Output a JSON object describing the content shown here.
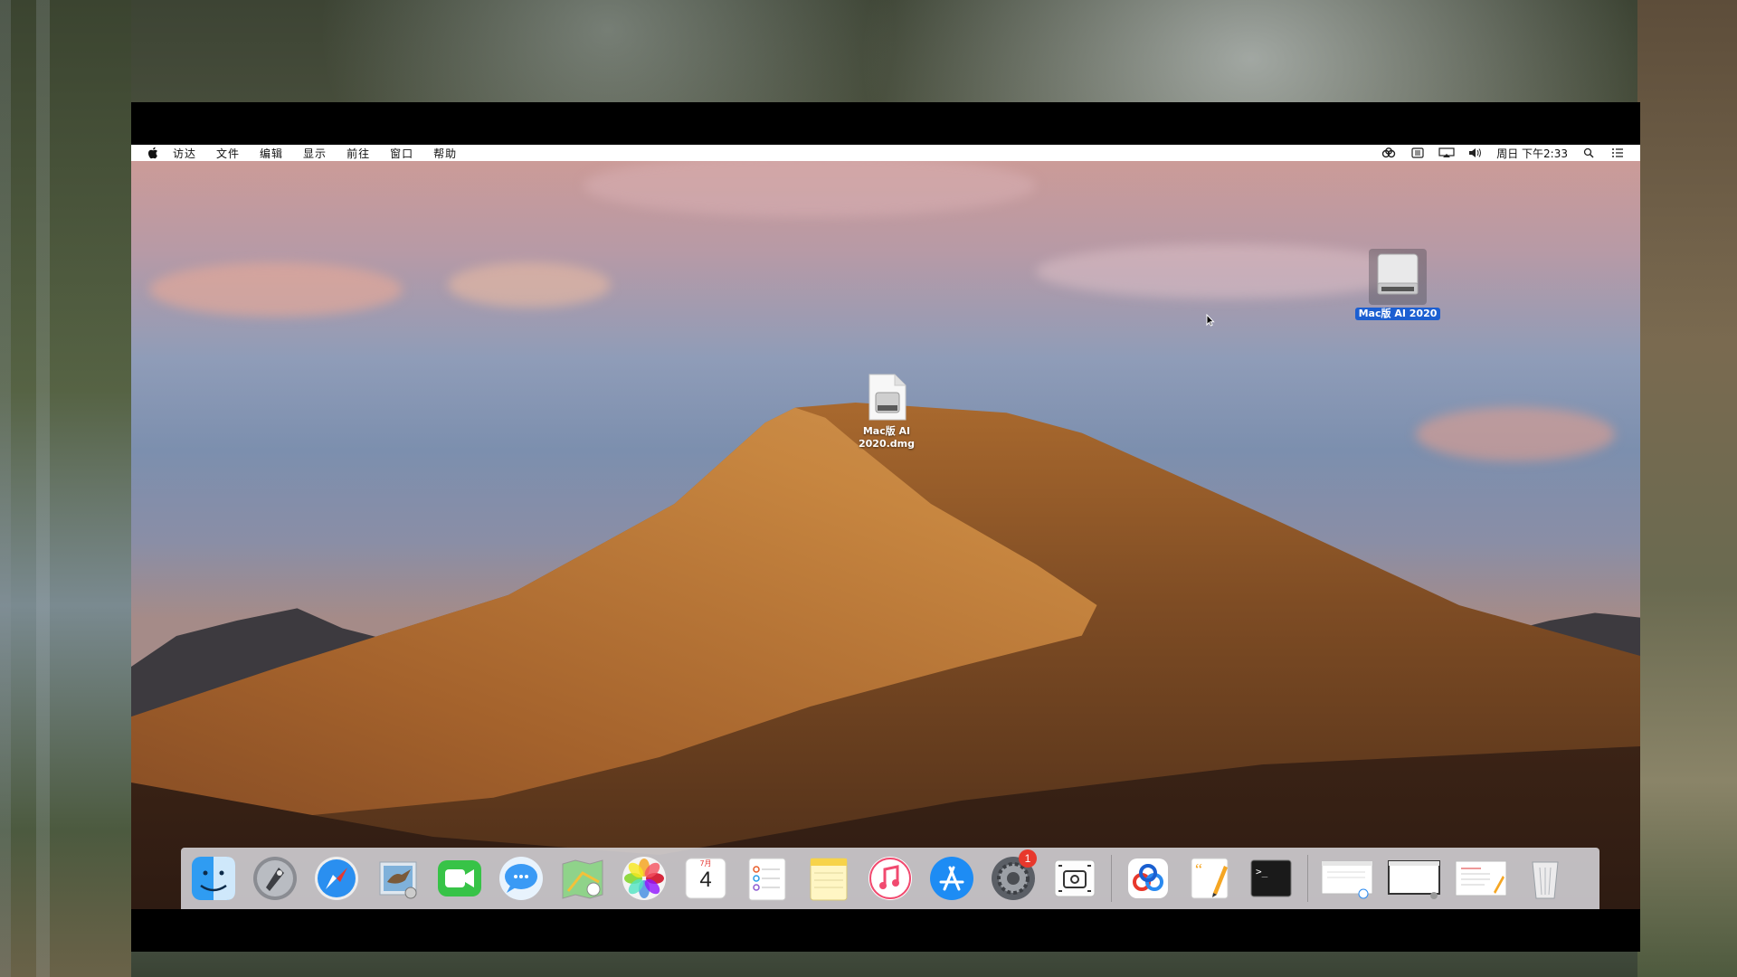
{
  "menubar": {
    "apple_icon": "apple-logo-icon",
    "menus": [
      "访达",
      "文件",
      "编辑",
      "显示",
      "前往",
      "窗口",
      "帮助"
    ],
    "status_icons": [
      "baidu-netdisk-icon",
      "input-source-icon",
      "airplay-icon",
      "volume-icon"
    ],
    "clock": "周日 下午2:33",
    "right_icons": [
      "spotlight-search-icon",
      "notification-center-icon"
    ]
  },
  "desktop": {
    "dmg_file": {
      "label_line1": "Mac版 AI",
      "label_line2": "2020.dmg",
      "icon": "dmg-file-icon"
    },
    "mounted_volume": {
      "label": "Mac版 AI 2020",
      "icon": "external-drive-icon",
      "selected": true
    }
  },
  "dock": {
    "apps": [
      "finder-icon",
      "launchpad-icon",
      "safari-icon",
      "mail-icon",
      "facetime-icon",
      "messages-icon",
      "maps-icon",
      "photos-icon",
      "calendar-icon",
      "reminders-icon",
      "notes-icon",
      "itunes-icon",
      "app-store-icon",
      "system-preferences-icon",
      "screenshot-icon"
    ],
    "calendar": {
      "month": "7月",
      "day": "4"
    },
    "system_prefs_badge": "1",
    "extra_apps": [
      "baidu-netdisk-icon",
      "pages-icon",
      "terminal-icon"
    ],
    "minimized": [
      "minimized-window-1",
      "minimized-window-2",
      "minimized-window-3"
    ],
    "trash": "trash-icon"
  },
  "colors": {
    "selection": "#1c5fd1",
    "badge": "#e8382c",
    "menubar": "#ffffff"
  }
}
